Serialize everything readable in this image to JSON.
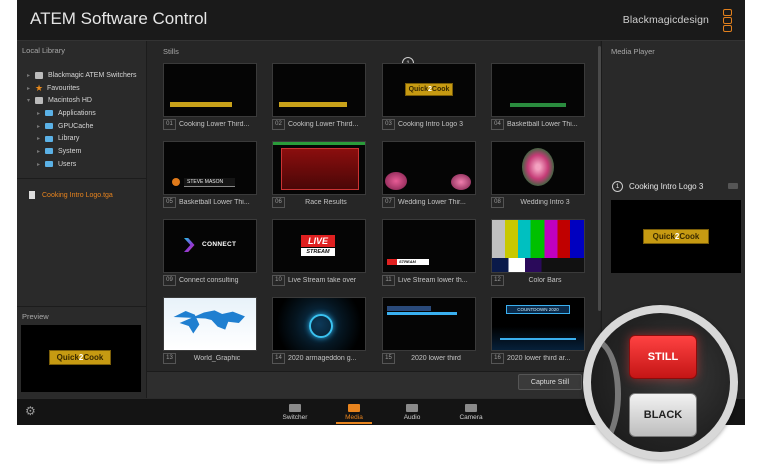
{
  "window": {
    "title": "ATEM Software Control",
    "brand": "Blackmagicdesign"
  },
  "local_library": {
    "label": "Local Library",
    "tree": [
      {
        "label": "Blackmagic ATEM Switchers",
        "icon": "device-icon"
      },
      {
        "label": "Favourites",
        "icon": "star-icon"
      },
      {
        "label": "Macintosh HD",
        "icon": "hard-drive-icon"
      },
      {
        "label": "Applications",
        "icon": "folder-icon"
      },
      {
        "label": "GPUCache",
        "icon": "folder-icon"
      },
      {
        "label": "Library",
        "icon": "folder-icon"
      },
      {
        "label": "System",
        "icon": "folder-icon"
      },
      {
        "label": "Users",
        "icon": "folder-icon"
      }
    ],
    "file": "Cooking Intro Logo.tga"
  },
  "preview": {
    "label": "Preview"
  },
  "logo": {
    "left": "Quick",
    "mid": "2",
    "right": "Cook"
  },
  "stills": {
    "label": "Stills",
    "items": [
      {
        "num": "01",
        "name": "Cooking Lower Third..."
      },
      {
        "num": "02",
        "name": "Cooking Lower Third..."
      },
      {
        "num": "03",
        "name": "Cooking Intro Logo 3",
        "badge": "1"
      },
      {
        "num": "04",
        "name": "Basketball Lower Thi..."
      },
      {
        "num": "05",
        "name": "Basketball Lower Thi..."
      },
      {
        "num": "06",
        "name": "Race Results"
      },
      {
        "num": "07",
        "name": "Wedding Lower Thir..."
      },
      {
        "num": "08",
        "name": "Wedding Intro 3"
      },
      {
        "num": "09",
        "name": "Connect consulting"
      },
      {
        "num": "10",
        "name": "Live Stream take over"
      },
      {
        "num": "11",
        "name": "Live Stream lower th..."
      },
      {
        "num": "12",
        "name": "Color Bars"
      },
      {
        "num": "13",
        "name": "World_Graphic"
      },
      {
        "num": "14",
        "name": "2020 armageddon g..."
      },
      {
        "num": "15",
        "name": "2020 lower third"
      },
      {
        "num": "16",
        "name": "2020 lower third ar..."
      }
    ],
    "thumb_text": {
      "basketball_name": "STEVE MASON",
      "connect": "CONNECT",
      "live": "LIVE",
      "stream": "STREAM",
      "countdown": "COUNTDOWN 2020"
    },
    "capture_label": "Capture Still"
  },
  "media_player": {
    "label": "Media Player",
    "badge": "1",
    "title": "Cooking Intro Logo 3"
  },
  "nav": {
    "items": [
      {
        "label": "Switcher",
        "icon": "switcher-icon",
        "active": false
      },
      {
        "label": "Media",
        "icon": "media-icon",
        "active": true
      },
      {
        "label": "Audio",
        "icon": "audio-icon",
        "active": false
      },
      {
        "label": "Camera",
        "icon": "camera-icon",
        "active": false
      }
    ]
  },
  "magnifier": {
    "still_label": "STILL",
    "black_label": "BLACK"
  },
  "colors": {
    "accent": "#e8841e",
    "still_red": "#e32626",
    "folder_blue": "#5bb1e6"
  }
}
